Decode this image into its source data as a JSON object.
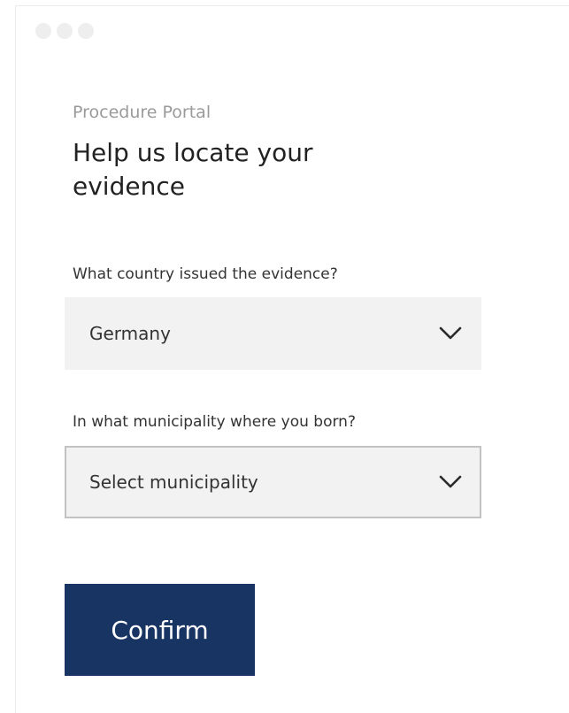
{
  "header": {
    "portal_name": "Procedure Portal",
    "title": "Help us locate your evidence"
  },
  "form": {
    "country": {
      "label": "What country issued the evidence?",
      "selected_value": "Germany",
      "icon": "chevron-down-icon"
    },
    "municipality": {
      "label": "In what municipality where you born?",
      "selected_value": "Select municipality",
      "icon": "chevron-down-icon"
    },
    "confirm_label": "Confirm"
  },
  "colors": {
    "primary_button": "#173463",
    "select_background": "#f2f2f2",
    "muted_text": "#9a9a9a"
  }
}
